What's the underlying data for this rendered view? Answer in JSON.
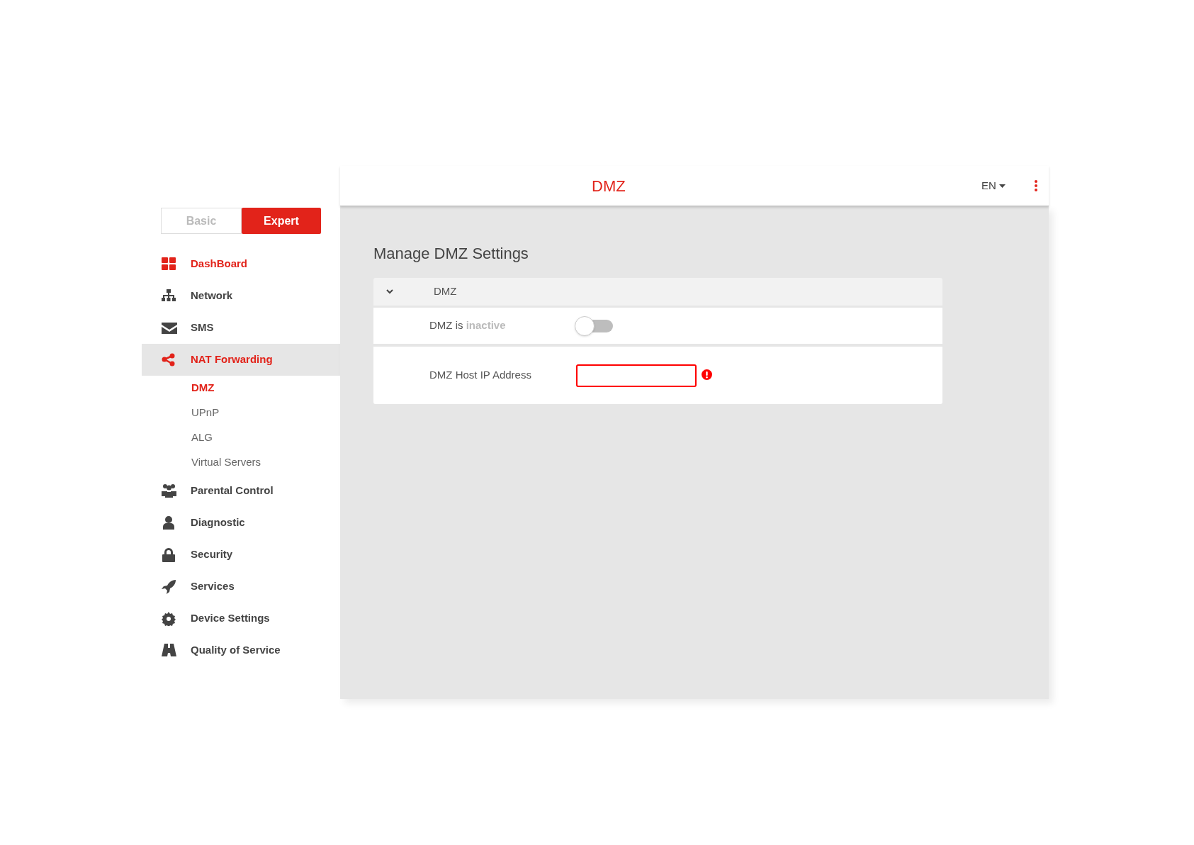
{
  "header": {
    "title": "DMZ",
    "language": "EN"
  },
  "mode_switch": [
    {
      "label": "Basic",
      "selected": false
    },
    {
      "label": "Expert",
      "selected": true
    }
  ],
  "sidebar": {
    "items": [
      {
        "label": "DashBoard",
        "active": true,
        "selected": false
      },
      {
        "label": "Network",
        "active": false,
        "selected": false
      },
      {
        "label": "SMS",
        "active": false,
        "selected": false
      },
      {
        "label": "NAT Forwarding",
        "active": true,
        "selected": true,
        "children": [
          {
            "label": "DMZ",
            "selected": true
          },
          {
            "label": "UPnP",
            "selected": false
          },
          {
            "label": "ALG",
            "selected": false
          },
          {
            "label": "Virtual Servers",
            "selected": false
          }
        ]
      },
      {
        "label": "Parental Control",
        "active": false,
        "selected": false
      },
      {
        "label": "Diagnostic",
        "active": false,
        "selected": false
      },
      {
        "label": "Security",
        "active": false,
        "selected": false
      },
      {
        "label": "Services",
        "active": false,
        "selected": false
      },
      {
        "label": "Device Settings",
        "active": false,
        "selected": false
      },
      {
        "label": "Quality of Service",
        "active": false,
        "selected": false
      }
    ]
  },
  "content": {
    "heading": "Manage DMZ Settings",
    "section": {
      "title": "DMZ",
      "expanded": true,
      "status_row": {
        "label": "DMZ is",
        "status": "inactive",
        "on": false
      },
      "host_ip": {
        "label": "DMZ Host IP Address",
        "error": true
      }
    }
  }
}
